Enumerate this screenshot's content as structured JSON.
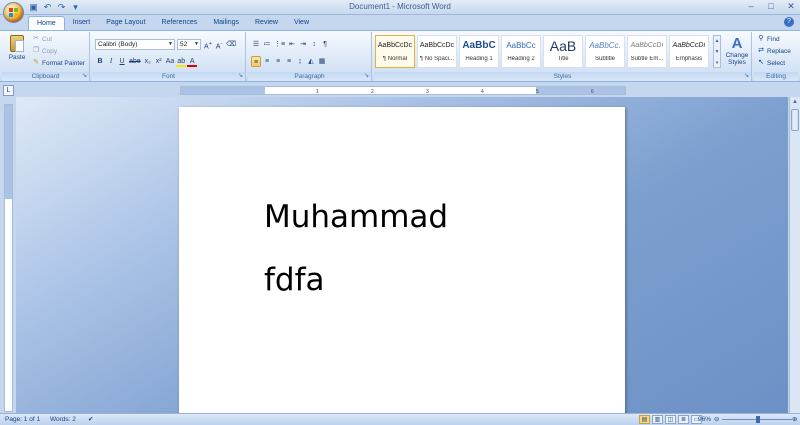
{
  "window": {
    "title": "Document1 - Microsoft Word",
    "controls": {
      "minimize": "–",
      "maximize": "□",
      "close": "✕"
    }
  },
  "quick_access": [
    {
      "name": "save-icon",
      "glyph": "▣"
    },
    {
      "name": "undo-icon",
      "glyph": "↶"
    },
    {
      "name": "redo-icon",
      "glyph": "↷"
    },
    {
      "name": "customize-qat-icon",
      "glyph": "▾"
    }
  ],
  "tabs": [
    "Home",
    "Insert",
    "Page Layout",
    "References",
    "Mailings",
    "Review",
    "View"
  ],
  "active_tab": "Home",
  "ribbon": {
    "clipboard": {
      "label": "Clipboard",
      "paste": "Paste",
      "cut": "Cut",
      "copy": "Copy",
      "format_painter": "Format Painter"
    },
    "font": {
      "label": "Font",
      "font_name": "Calibri (Body)",
      "font_size": "52"
    },
    "paragraph": {
      "label": "Paragraph"
    },
    "styles": {
      "label": "Styles",
      "items": [
        {
          "sample": "AaBbCcDc",
          "name": "¶ Normal"
        },
        {
          "sample": "AaBbCcDc",
          "name": "¶ No Spaci..."
        },
        {
          "sample": "AaBbC",
          "name": "Heading 1"
        },
        {
          "sample": "AaBbCc",
          "name": "Heading 2"
        },
        {
          "sample": "AaB",
          "name": "Title"
        },
        {
          "sample": "AaBbCc.",
          "name": "Subtitle"
        },
        {
          "sample": "AaBbCcDı",
          "name": "Subtle Em..."
        },
        {
          "sample": "AaBbCcDı",
          "name": "Emphasis"
        }
      ],
      "selected": 0,
      "change_styles": "Change Styles"
    },
    "editing": {
      "label": "Editing",
      "find": "Find",
      "replace": "Replace",
      "select": "Select"
    }
  },
  "document": {
    "paragraphs": [
      "Muhammad",
      "fdfa"
    ]
  },
  "status": {
    "page": "Page: 1 of 1",
    "words": "Words: 2",
    "zoom": "96%"
  }
}
